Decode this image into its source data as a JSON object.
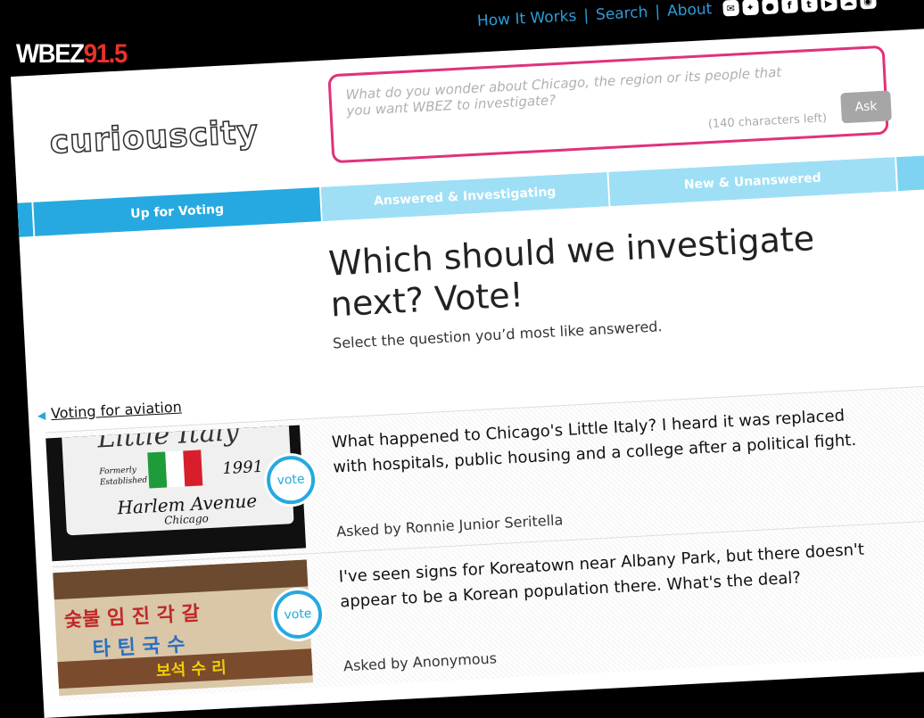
{
  "brand": {
    "logo_main": "WBEZ",
    "logo_num": "91.5",
    "section_logo": "curiouscity"
  },
  "topnav": {
    "how": "How It Works",
    "search": "Search",
    "about": "About",
    "sep": "|"
  },
  "social_icons": [
    "email-icon",
    "twitter-icon",
    "flickr-icon",
    "facebook-icon",
    "tumblr-icon",
    "youtube-icon",
    "soundcloud-icon",
    "rss-icon"
  ],
  "ask": {
    "placeholder": "What do you wonder about Chicago, the region or its people that you want WBEZ to investigate?",
    "chars_left": "(140 characters left)",
    "button": "Ask"
  },
  "tabs": [
    "Up for Voting",
    "Answered & Investigating",
    "New & Unanswered"
  ],
  "page": {
    "title": "Which should we investigate next? Vote!",
    "subtitle": "Select the question you’d most like answered.",
    "back_link": "Voting for aviation"
  },
  "questions": [
    {
      "text": "What happened to Chicago's Little Italy? I heard it was replaced with hospitals, public housing and a college after a political fight.",
      "asked_by": "Asked by Ronnie Junior Seritella",
      "vote": "vote",
      "image_sign": {
        "top": "Little Italy",
        "left1": "Formerly",
        "left2": "Established",
        "year": "1991",
        "street": "Harlem Avenue",
        "city": "Chicago"
      }
    },
    {
      "text": "I've seen signs for Koreatown near Albany Park, but there doesn't appear to be a Korean population there. What's the deal?",
      "asked_by": "Asked by Anonymous",
      "vote": "vote",
      "image_sign": {
        "line1": "숯불 임 진 각 갈",
        "line2": "타 틴 국 수",
        "line3": "보석 수 리"
      }
    }
  ],
  "colors": {
    "brand_red": "#e8322b",
    "accent_blue": "#26a9e0",
    "ask_pink": "#e0327a",
    "tab_light": "#9edff6"
  }
}
